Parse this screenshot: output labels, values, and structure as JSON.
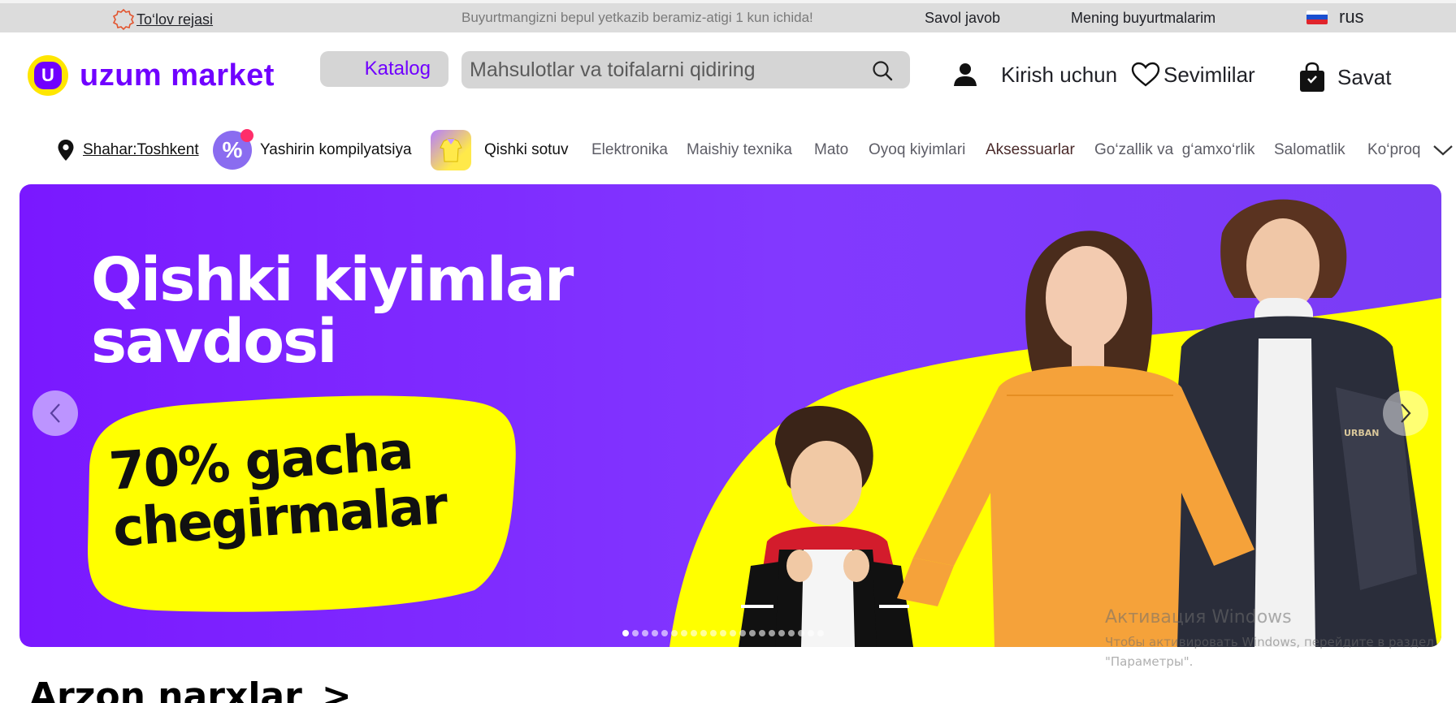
{
  "topbar": {
    "payment_plan": "To‘lov rejasi",
    "promo": "Buyurtmangizni bepul yetkazib beramiz-atigi 1 kun ichida!",
    "faq": "Savol javob",
    "my_orders": "Mening buyurtmalarim",
    "language": "rus",
    "colors": {
      "bg": "#dcdcdc",
      "promo_text": "#7a7a7a"
    }
  },
  "header": {
    "logo_text": "uzum market",
    "logo_letter": "U",
    "catalog_label": "Katalog",
    "search_placeholder": "Mahsulotlar va toifalarni qidiring",
    "login_label": "Kirish uchun",
    "favorites_label": "Sevimlilar",
    "cart_label": "Savat",
    "colors": {
      "brand": "#7000ff",
      "brand_yellow": "#ffe600",
      "field_bg": "#d5d5d5"
    }
  },
  "catnav": {
    "city": "Shahar:Toshkent",
    "hidden_collection": "Yashirin kompilyatsiya",
    "hidden_badge": "%",
    "winter_sale": "Qishki sotuv",
    "links": [
      "Elektronika",
      "Maishiy texnika",
      "Mato",
      "Oyoq kiyimlari",
      "Aksessuarlar",
      "Go‘zallik va  g‘amxo‘rlik",
      "Salomatlik",
      "Ko‘proq"
    ]
  },
  "banner": {
    "title_line1": "Qishki kiyimlar",
    "title_line2": "savdosi",
    "sale_line1": "70% gacha",
    "sale_line2": "chegirmalar",
    "jacket_print": "URBAN",
    "slide_count": 21,
    "active_slide": 1,
    "colors": {
      "bg": "#7a18ff",
      "accent": "#ffff00"
    }
  },
  "watermark": {
    "line1": "Активация Windows",
    "line2": "Чтобы активировать Windows, перейдите в раздел",
    "line3": "\"Параметры\"."
  },
  "section": {
    "title": "Arzon narxlar",
    "arrow": ">"
  }
}
